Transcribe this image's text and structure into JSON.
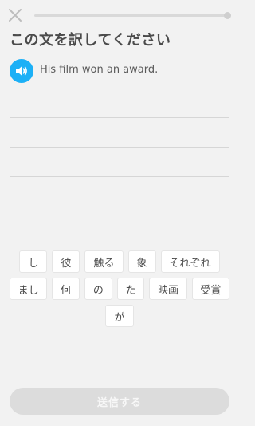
{
  "header": {
    "close_icon": "close-icon",
    "progress_fraction": 0.0
  },
  "title": "この文を訳してください",
  "prompt": {
    "speaker_icon": "speaker-icon",
    "accent_color": "#1cb0f6",
    "sentence": "His film won an award."
  },
  "word_bank": {
    "rows": [
      [
        "し",
        "彼",
        "触る",
        "象",
        "それぞれ"
      ],
      [
        "まし",
        "何",
        "の",
        "た",
        "映画",
        "受賞"
      ],
      [
        "が"
      ]
    ]
  },
  "submit": {
    "label": "送信する",
    "enabled": false
  }
}
